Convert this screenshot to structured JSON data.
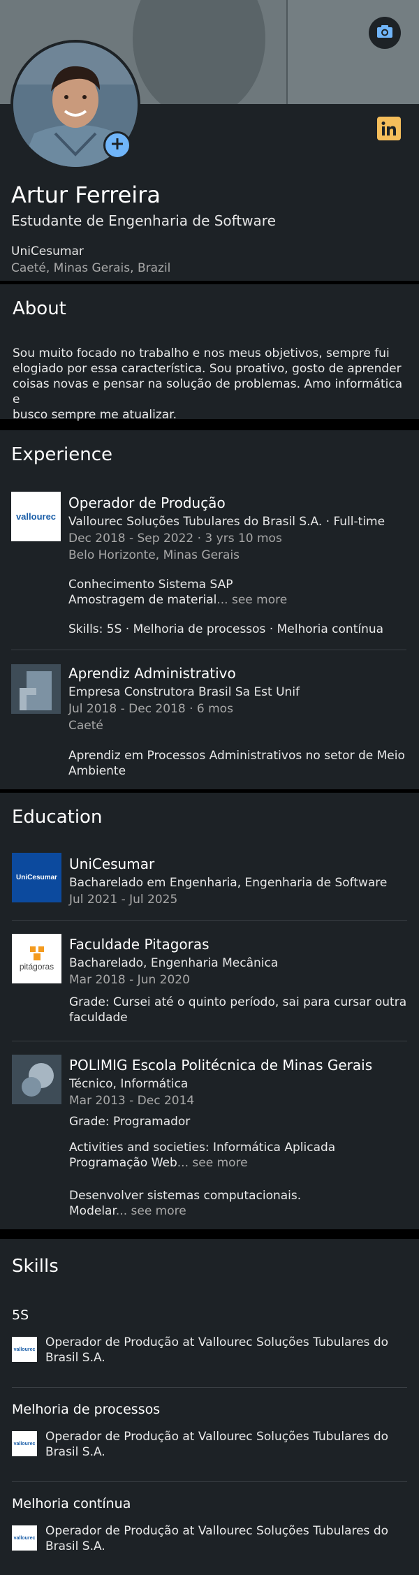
{
  "profile": {
    "name": "Artur Ferreira",
    "headline": "Estudante de Engenharia de Software",
    "school": "UniCesumar",
    "location": "Caeté, Minas Gerais, Brazil"
  },
  "icons": {
    "camera": "camera-icon",
    "add": "plus-icon",
    "linkedin": "linkedin-icon"
  },
  "colors": {
    "card_bg": "#1d2226",
    "accent": "#70b5f9",
    "linkedin_badge": "#f5be5b",
    "secondary_text": "#a8a8a8"
  },
  "about": {
    "heading": "About",
    "lines": [
      "Sou muito focado no trabalho e nos meus objetivos, sempre fui",
      "elogiado por essa característica. Sou proativo, gosto de aprender",
      "coisas novas e pensar na solução de problemas. Amo informática e",
      "busco sempre me atualizar."
    ]
  },
  "experience": {
    "heading": "Experience",
    "items": [
      {
        "logo_text": "vallourec",
        "title": "Operador de Produção",
        "company": "Vallourec Soluções Tubulares do Brasil S.A. · Full-time",
        "dates": "Dec 2018 - Sep 2022 · 3 yrs 10 mos",
        "location": "Belo Horizonte, Minas Gerais",
        "desc_line1": "Conhecimento Sistema SAP",
        "desc_line2": "Amostragem de material",
        "see_more": "... see more",
        "skills": "Skills: 5S · Melhoria de processos · Melhoria contínua"
      },
      {
        "title": "Aprendiz Administrativo",
        "company": "Empresa Construtora Brasil Sa Est Unif",
        "dates": "Jul 2018 - Dec 2018 · 6 mos",
        "location": "Caeté",
        "desc_line1": "Aprendiz em Processos Administrativos no setor de Meio",
        "desc_line2": "Ambiente"
      }
    ]
  },
  "education": {
    "heading": "Education",
    "items": [
      {
        "logo_text": "UniCesumar",
        "school": "UniCesumar",
        "degree": "Bacharelado em Engenharia, Engenharia de Software",
        "dates": "Jul 2021 - Jul 2025"
      },
      {
        "logo_text": "pitágoras",
        "school": "Faculdade Pitagoras",
        "degree": "Bacharelado, Engenharia Mecânica",
        "dates": "Mar 2018 - Jun 2020",
        "grade_line1": "Grade: Cursei até o quinto período, sai para cursar outra",
        "grade_line2": "faculdade"
      },
      {
        "school": "POLIMIG Escola Politécnica de Minas Gerais",
        "degree": "Técnico, Informática",
        "dates": "Mar 2013 - Dec 2014",
        "grade": "Grade: Programador",
        "activities_line1": "Activities and societies: Informática Aplicada",
        "activities_line2": "Programação Web",
        "desc_line1": "Desenvolver sistemas computacionais.",
        "desc_line2": "Modelar",
        "see_more": "... see more"
      }
    ]
  },
  "skills": {
    "heading": "Skills",
    "items": [
      {
        "name": "5S",
        "context_line1": "Operador de Produção at Vallourec Soluções Tubulares do",
        "context_line2": "Brasil S.A."
      },
      {
        "name": "Melhoria de processos",
        "context_line1": "Operador de Produção at Vallourec Soluções Tubulares do",
        "context_line2": "Brasil S.A."
      },
      {
        "name": "Melhoria contínua",
        "context_line1": "Operador de Produção at Vallourec Soluções Tubulares do",
        "context_line2": "Brasil S.A."
      }
    ]
  }
}
